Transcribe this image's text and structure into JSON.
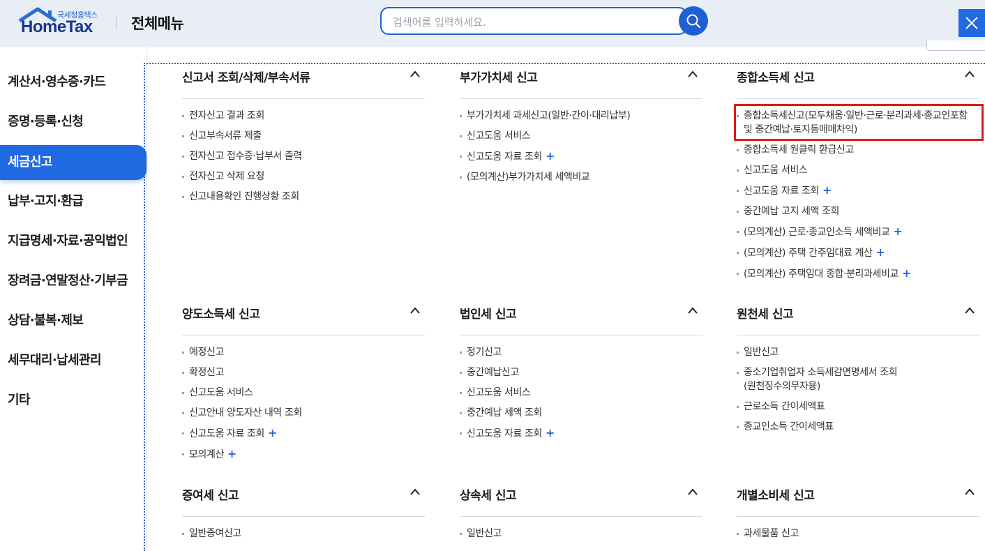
{
  "header": {
    "logo_sub": "국세청홈택스",
    "logo_main": "HomeTax",
    "title": "전체메뉴",
    "search_placeholder": "검색어를 입력하세요."
  },
  "sidebar": {
    "items": [
      {
        "label": "계산서·영수증·카드"
      },
      {
        "label": "증명·등록·신청"
      },
      {
        "label": "세금신고",
        "active": true
      },
      {
        "label": "납부·고지·환급"
      },
      {
        "label": "지급명세·자료·공익법인"
      },
      {
        "label": "장려금·연말정산·기부금"
      },
      {
        "label": "상담·불복·제보"
      },
      {
        "label": "세무대리·납세관리"
      },
      {
        "label": "기타"
      }
    ]
  },
  "sections": [
    {
      "title": "신고서 조회/삭제/부속서류",
      "items": [
        {
          "label": "전자신고 결과 조회"
        },
        {
          "label": "신고부속서류 제출"
        },
        {
          "label": "전자신고 접수증·납부서 출력"
        },
        {
          "label": "전자신고 삭제 요청"
        },
        {
          "label": "신고내용확인 진행상황 조회"
        }
      ]
    },
    {
      "title": "부가가치세 신고",
      "items": [
        {
          "label": "부가가치세 과세신고(일반·간이·대리납부)"
        },
        {
          "label": "신고도움 서비스"
        },
        {
          "label": "신고도움 자료 조회",
          "plus": "+"
        },
        {
          "label": "(모의계산)부가가치세 세액비교"
        }
      ]
    },
    {
      "title": "종합소득세 신고",
      "items": [
        {
          "label": "종합소득세신고(모두채움·일반·근로·분리과세·종교인포함",
          "label2": "및 중간예납·토지등매매차익)"
        },
        {
          "label": "종합소득세 원클릭 환급신고"
        },
        {
          "label": "신고도움 서비스"
        },
        {
          "label": "신고도움 자료 조회",
          "plus": "+"
        },
        {
          "label": "중간예납 고지 세액 조회"
        },
        {
          "label": "(모의계산) 근로·종교인소득 세액비교",
          "plus": "+"
        },
        {
          "label": "(모의계산) 주택 간주임대료 계산",
          "plus": "+"
        },
        {
          "label": "(모의계산) 주택임대 종합·분리과세비교",
          "plus": "+"
        }
      ]
    },
    {
      "title": "양도소득세 신고",
      "items": [
        {
          "label": "예정신고"
        },
        {
          "label": "확정신고"
        },
        {
          "label": "신고도움 서비스"
        },
        {
          "label": "신고안내 양도자산 내역 조회"
        },
        {
          "label": "신고도움 자료 조회",
          "plus": "+"
        },
        {
          "label": "모의계산",
          "plus": "+"
        }
      ]
    },
    {
      "title": "법인세 신고",
      "items": [
        {
          "label": "정기신고"
        },
        {
          "label": "중간예납신고"
        },
        {
          "label": "신고도움 서비스"
        },
        {
          "label": "중간예납 세액 조회"
        },
        {
          "label": "신고도움 자료 조회",
          "plus": "+"
        }
      ]
    },
    {
      "title": "원천세 신고",
      "items": [
        {
          "label": "일반신고"
        },
        {
          "label": "중소기업취업자 소득세감면명세서 조회",
          "label2": "(원천징수의무자용)"
        },
        {
          "label": "근로소득 간이세액표"
        },
        {
          "label": "종교인소득 간이세액표"
        }
      ]
    },
    {
      "title": "증여세 신고",
      "items": [
        {
          "label": "일반증여신고"
        }
      ]
    },
    {
      "title": "상속세 신고",
      "items": [
        {
          "label": "일반신고"
        }
      ]
    },
    {
      "title": "개별소비세 신고",
      "items": [
        {
          "label": "과세물품 신고"
        }
      ]
    }
  ],
  "colors": {
    "accent": "#1f6ae0",
    "highlight_border": "#e01a1a",
    "header_bg": "#e9eef6"
  }
}
